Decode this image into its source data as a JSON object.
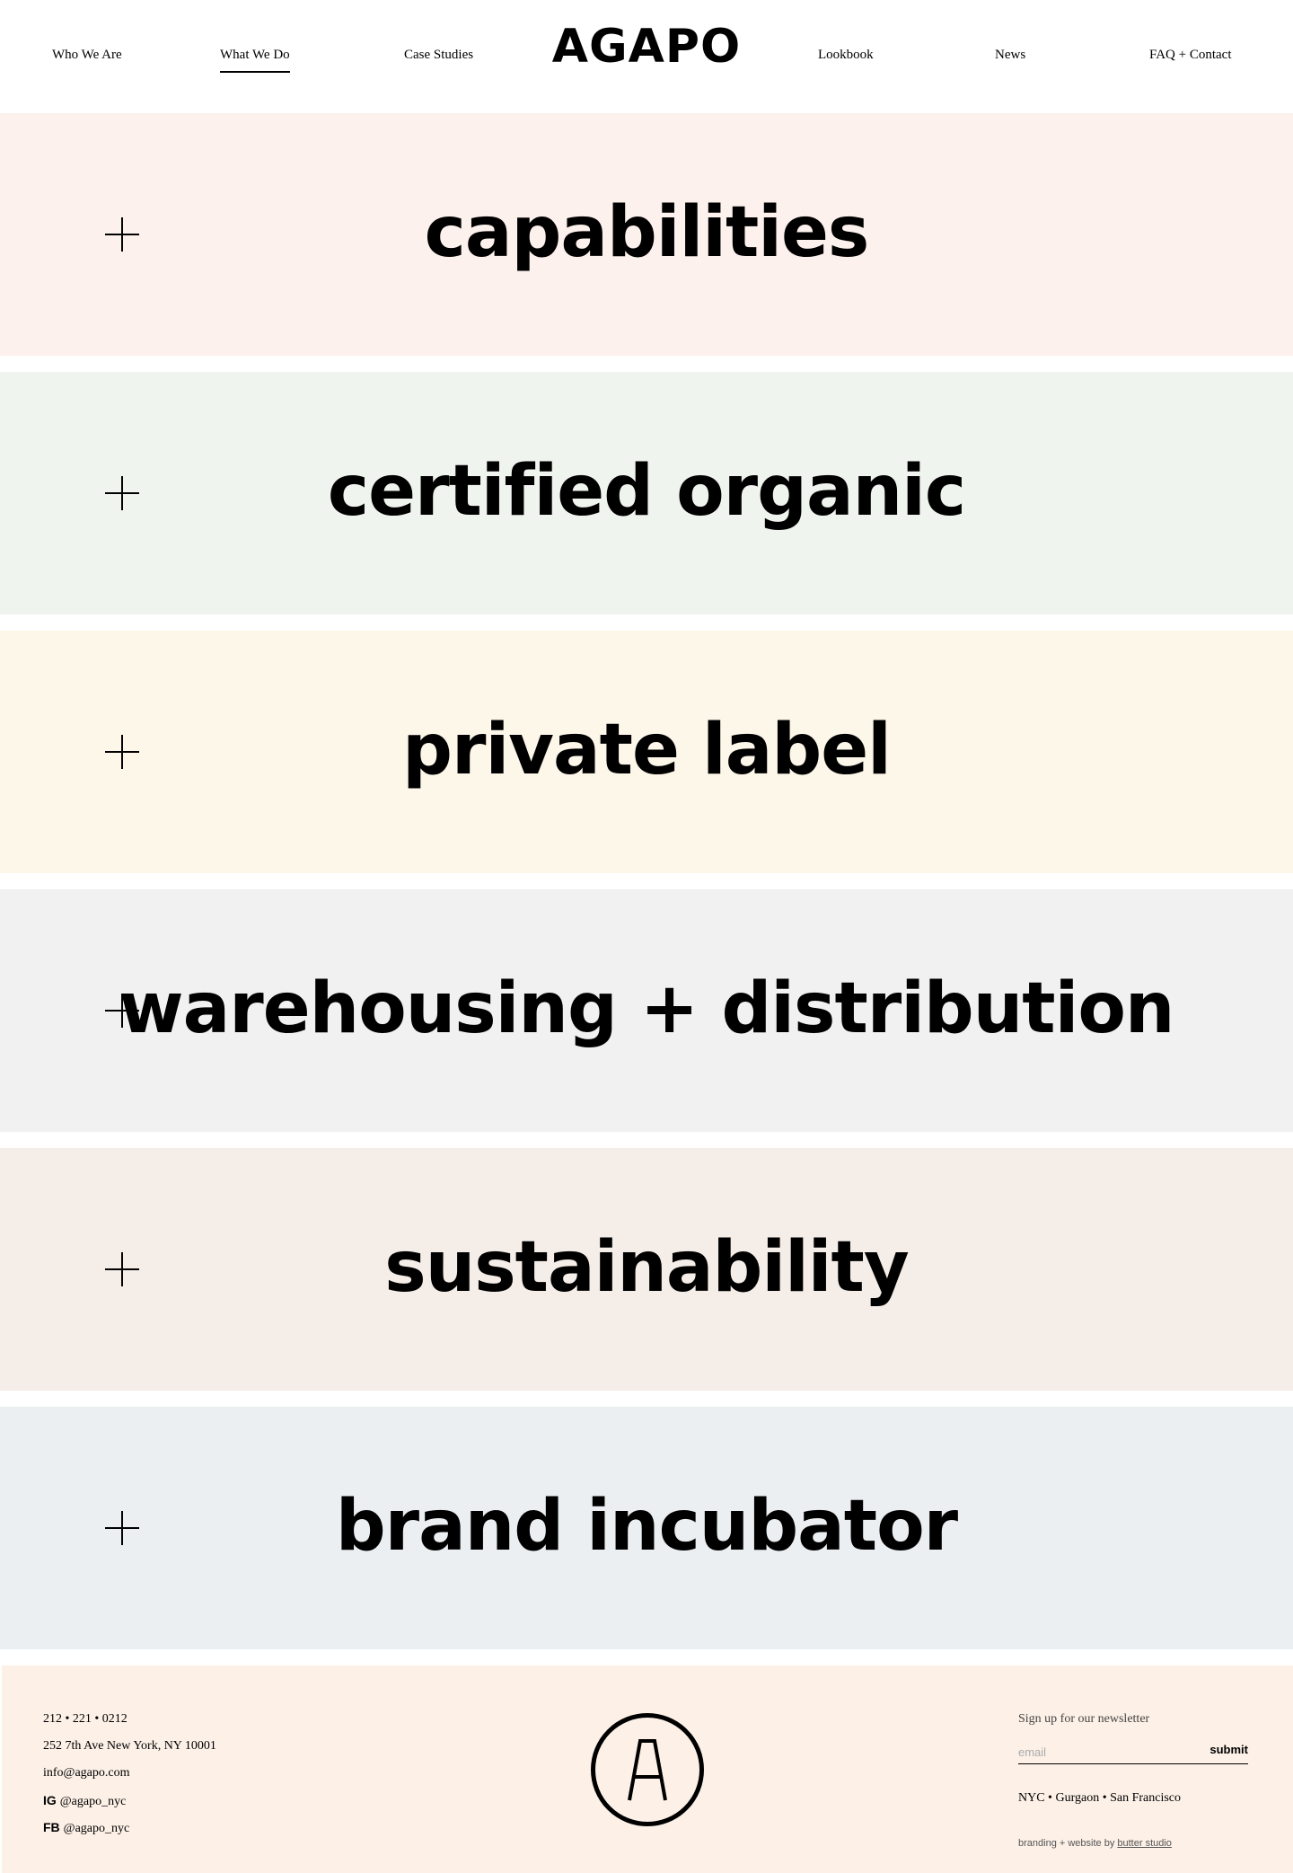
{
  "header": {
    "logo": "AGAPO",
    "nav": [
      {
        "label": "Who We Are"
      },
      {
        "label": "What We Do",
        "active": true
      },
      {
        "label": "Case Studies"
      },
      {
        "label": "Lookbook"
      },
      {
        "label": "News"
      },
      {
        "label": "FAQ + Contact"
      }
    ]
  },
  "sections": [
    {
      "title": "capabilities",
      "color": "#fcf1ed"
    },
    {
      "title": "certified organic",
      "color": "#f0f4ee"
    },
    {
      "title": "private label",
      "color": "#fdf7ea"
    },
    {
      "title": "warehousing + distribution",
      "color": "#f1f1f1"
    },
    {
      "title": "sustainability",
      "color": "#f5ede8"
    },
    {
      "title": "brand incubator",
      "color": "#eceff1"
    }
  ],
  "footer": {
    "phone": "212 • 221 • 0212",
    "address": "252 7th Ave  New York, NY 10001",
    "email": "info@agapo.com",
    "ig_label": "IG",
    "ig_handle": "@agapo_nyc",
    "fb_label": "FB",
    "fb_handle": "@agapo_nyc",
    "badge_letter": "A",
    "newsletter_label": "Sign up for our newsletter",
    "email_placeholder": "email",
    "submit_label": "submit",
    "locations": "NYC • Gurgaon • San Francisco",
    "credit_prefix": "branding + website by",
    "credit_link": "butter studio",
    "background": "#fcf0e7"
  }
}
